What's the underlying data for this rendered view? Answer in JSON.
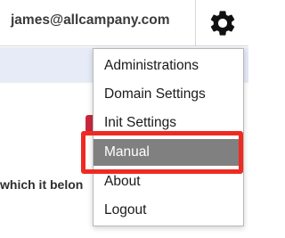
{
  "header": {
    "user_email": "james@allcampany.com",
    "settings_icon": "gear-icon"
  },
  "background": {
    "partial_text": "which it belon"
  },
  "menu": {
    "items": [
      {
        "label": "Administrations"
      },
      {
        "label": "Domain Settings"
      },
      {
        "label": "Init Settings"
      },
      {
        "label": "Manual",
        "selected": true
      },
      {
        "label": "About"
      },
      {
        "label": "Logout"
      }
    ]
  },
  "colors": {
    "selected_item": "#808080",
    "highlight": "#ee2b22",
    "band": "#e6ebf7"
  }
}
